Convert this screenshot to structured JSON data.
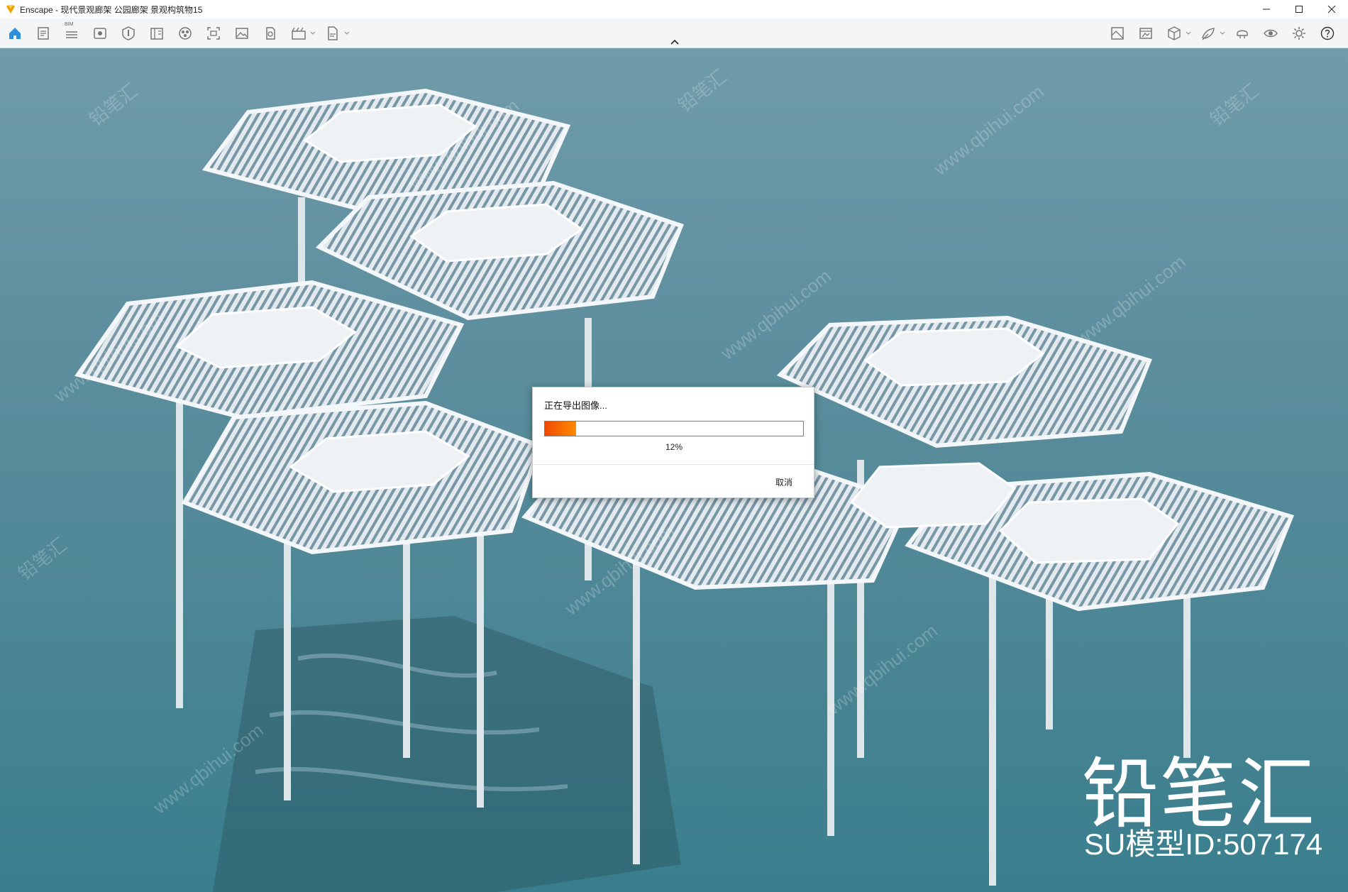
{
  "window": {
    "title": "Enscape - 现代景观廊架 公园廊架 景观构筑物15",
    "controls": [
      "minimize-icon",
      "maximize-icon",
      "close-icon"
    ]
  },
  "toolbar": {
    "bim_label": "BIM",
    "left_icons": [
      "home-icon",
      "file-icon",
      "bim-icon",
      "view-icon",
      "visual-settings-icon",
      "sun-icon",
      "asset-library-icon",
      "screenshot-icon",
      "image-export-icon",
      "panorama-icon",
      "video-icon",
      "exe-export-icon"
    ],
    "right_icons": [
      "map-icon",
      "batch-render-icon",
      "cube-icon",
      "collaborative-icon",
      "vr-headset-icon",
      "eye-icon",
      "settings-icon",
      "help-icon"
    ]
  },
  "dialog": {
    "title": "正在导出图像...",
    "progress": 0.12,
    "progress_text": "12%",
    "cancel_label": "取消",
    "progress_color_start": "#f04a00",
    "progress_color_end": "#ff8a00"
  },
  "watermark": {
    "brand": "铅笔汇",
    "model_id": "SU模型ID:507174",
    "tile_cn": "铅笔汇",
    "tile_url": "www.qbihui.com"
  }
}
